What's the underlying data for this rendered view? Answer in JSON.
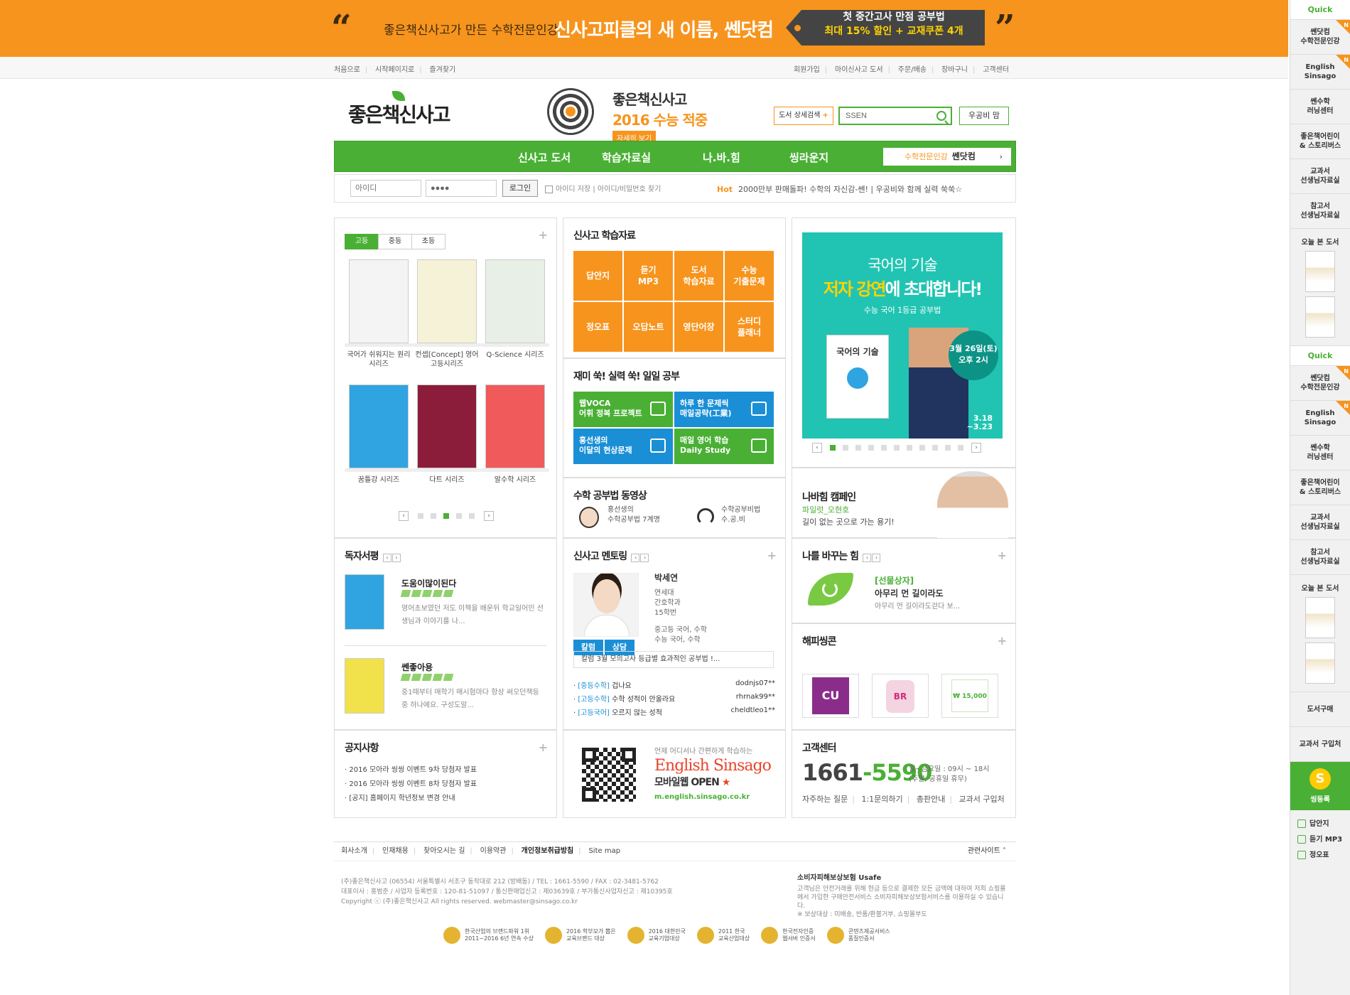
{
  "top_banner": {
    "sub": "좋은책신사고가 만든 수학전문인강",
    "main": "신사고피클의 새 이름, 쎈닷컴",
    "promo_line1": "첫 중간고사 만점 공부법",
    "promo_line2": "최대 15% 할인 + 교재쿠폰 4개",
    "open_quote": "“",
    "close_quote": "”"
  },
  "util": {
    "left": [
      "처음으로",
      "시작페이지로",
      "즐겨찾기"
    ],
    "right": [
      "회원가입",
      "마이신사고 도서",
      "주문/배송",
      "장바구니",
      "고객센터"
    ]
  },
  "header": {
    "logo": "좋은책신사고",
    "csat_line1": "좋은책신사고",
    "csat_line2": "2016 수능 적중",
    "csat_more": "자세히 보기",
    "detail_search": "도서 상세검색",
    "search_value": "SSEN",
    "workbook": "우공비 맘"
  },
  "gnav": {
    "items": [
      "신사고 도서",
      "학습자료실",
      "나.바.힘",
      "씽라운지"
    ],
    "ssen_prefix": "수학전문인강",
    "ssen_brand": "쎈닷컴",
    "arrow": "›"
  },
  "login": {
    "id_placeholder": "아이디",
    "pw_value": "●●●●",
    "button": "로그인",
    "save_id": "아이디 저장",
    "find": "아이디/비밀번호 찾기",
    "hot_label": "Hot",
    "hot_text": "2000만부 판매돌파! 수학의 자신감-쎈!",
    "hot_text2": "우공비와 함께 실력 쑥쑥☆"
  },
  "books_panel": {
    "tabs": [
      "고등",
      "중등",
      "초등"
    ],
    "books": [
      {
        "label": "국어가 쉬워지는 원리 시리즈",
        "color": "#f4f4f4"
      },
      {
        "label": "컨셉[Concept] 영어 고등시리즈",
        "color": "#f6f2d8"
      },
      {
        "label": "Q-Science 시리즈",
        "color": "#e8efe6"
      },
      {
        "label": "꿈틀강 시리즈",
        "color": "#2fa4e0"
      },
      {
        "label": "다트 시리즈",
        "color": "#8b1d3a"
      },
      {
        "label": "알수학 시리즈",
        "color": "#f05a5a"
      }
    ],
    "pager_prev": "‹",
    "pager_next": "›"
  },
  "materials": {
    "title": "신사고 학습자료",
    "grid": [
      "답안지",
      "듣기\nMP3",
      "도서\n학습자료",
      "수능\n기출문제",
      "정오표",
      "오답노트",
      "영단어장",
      "스터디\n플래너"
    ]
  },
  "daily": {
    "title": "재미 쑥! 실력 쑥! 일일 공부",
    "items": [
      {
        "text": "웹VOCA\n어휘 정복 프로젝트",
        "color": "#4ab035"
      },
      {
        "text": "하루 한 문제씩\n매일공략(工業)",
        "color": "#1a8fd6"
      },
      {
        "text": "홍선생의\n이달의 현상문제",
        "color": "#1a8fd6"
      },
      {
        "text": "매일 영어 학습\nDaily Study",
        "color": "#4ab035"
      }
    ]
  },
  "video": {
    "title": "수학 공부법 동영상",
    "a": "홍선생의\n수학공부법 7계명",
    "b": "수학공부비법\n수.공.비"
  },
  "event_banner": {
    "line1": "국어의 기술",
    "line2a": "저자 강연",
    "line2b": "에 초대합니다!",
    "line3": "수능 국어 1등급 공부법",
    "book": "국어의 기술",
    "date": "3월 26일(토)\n오후 2시",
    "period": "3.18\n~3.23"
  },
  "campaign": {
    "title": "나바힘 캠페인",
    "sub": "파일럿_오현호",
    "desc": "길이 없는 곳으로 가는 용기!"
  },
  "reviews": {
    "title": "독자서평",
    "items": [
      {
        "title": "도움이많이된다",
        "desc": "영어초보였던 저도 이책을 배운뒤 학교일어민 선생님과 이야기를 나...",
        "cover": "#2fa4e0"
      },
      {
        "title": "쎈좋아용",
        "desc": "중1때부터 매학기 매시험마다 항상 써오던책등중 하나에요. 구성도알...",
        "cover": "#f1e14b"
      }
    ]
  },
  "mentoring": {
    "title": "신사고 멘토링",
    "name": "박세연",
    "info": [
      "연세대",
      "간호학과",
      "15학번"
    ],
    "subjects": [
      "중고등 국어, 수학",
      "수능 국어, 수학"
    ],
    "btn1": "칼럼",
    "btn2": "상담",
    "column": "칼럼  3월 모의고사 등급별 효과적인 공부법 !...",
    "qa": [
      {
        "cat": "[중등수학]",
        "text": "겁나요",
        "user": "dodnjs07**"
      },
      {
        "cat": "[고등수학]",
        "text": "수학 성적이 안올라요",
        "user": "rhrnak99**"
      },
      {
        "cat": "[고등국어]",
        "text": "오르지 않는 성적",
        "user": "cheldtleo1**"
      }
    ]
  },
  "power": {
    "title": "나를 바꾸는 힘",
    "tag": "[선물상자]",
    "head": "아무리 먼 길이라도",
    "desc": "아무리 먼 길이라도걷다 보..."
  },
  "happy": {
    "title": "해피씽콘",
    "items": [
      "CU",
      "BR",
      "₩ 15,000"
    ]
  },
  "notice": {
    "title": "공지사항",
    "items": [
      "2016 모아라 씽씽 이벤트 9차 당첨자 발표",
      "2016 모아라 씽씽 이벤트 8차 당첨자 발표",
      "[공지] 홈페이지 학년정보 변경 안내"
    ]
  },
  "english": {
    "line1": "언제 어디서나 간편하게 학습하는",
    "brand": "English Sinsago",
    "line2": "모바일웹 OPEN",
    "star": "★",
    "url": "m.english.sinsago.co.kr"
  },
  "cs": {
    "title": "고객센터",
    "phone_a": "1661",
    "phone_b": "-",
    "phone_c": "5590",
    "hours": "월~금요일 : 09시 ~ 18시\n(주말, 공휴일 휴무)",
    "links": [
      "자주하는 질문",
      "1:1문의하기",
      "총판안내",
      "교과서 구입처"
    ]
  },
  "footer": {
    "nav": [
      "회사소개",
      "인재채용",
      "찾아오시는 길",
      "이용약관",
      "개인정보취급방침",
      "Site map"
    ],
    "related": "관련사이트",
    "text": "(주)좋은책신사고 (06554) 서울특별시 서초구 동작대로 212 (방배동) / TEL : 1661-5590 / FAX : 02-3481-5762\n대표이사 : 홍범준 / 사업자 등록번호 : 120-81-51097 / 통신판매업신고 : 제03639호 / 부가통신사업자신고 : 제10395호\nCopyright ⓒ (주)좋은책신사고 All rights reserved.  webmaster@sinsago.co.kr",
    "usafe_title": "소비자피해보상보험 Usafe",
    "usafe_text": "고객님은 안전거래를 위해 현금 등으로 결제한 모든 금액에 대하여 저희 쇼핑몰에서 가입한 구매안전서비스 소비자피해보상보험서비스를 이용하실 수 있습니다.\n※ 보상대상 : 미배송, 반품/환불거부, 쇼핑몰부도",
    "awards": [
      "한국산업의 브랜드파워 1위\n2011~2016 6년 연속 수상",
      "2016 학부모가 뽑은\n교육브랜드 대상",
      "2016 대한민국\n교육기업대상",
      "2011 한국\n교육산업대상",
      "한국전자인증\n웹서버 인증서",
      "콘텐츠제공서비스\n품질인증서"
    ]
  },
  "quick": {
    "label": "Quick",
    "items": [
      {
        "text": "쎈닷컴\n수학전문인강",
        "new": true
      },
      {
        "text": "English\nSinsago",
        "new": true
      },
      {
        "text": "쎈수학\n러닝센터",
        "new": false
      },
      {
        "text": "좋은책어린이\n& 스토리버스",
        "new": false
      },
      {
        "text": "교과서\n선생님자료실",
        "new": false
      },
      {
        "text": "참고서\n선생님자료실",
        "new": false
      }
    ],
    "today": "오늘 본 도서",
    "buy": "도서구매",
    "textbook": "교과서 구입처",
    "sing": "씽등록",
    "links": [
      "답안지",
      "듣기 MP3",
      "정오표"
    ],
    "new_mark": "N"
  }
}
